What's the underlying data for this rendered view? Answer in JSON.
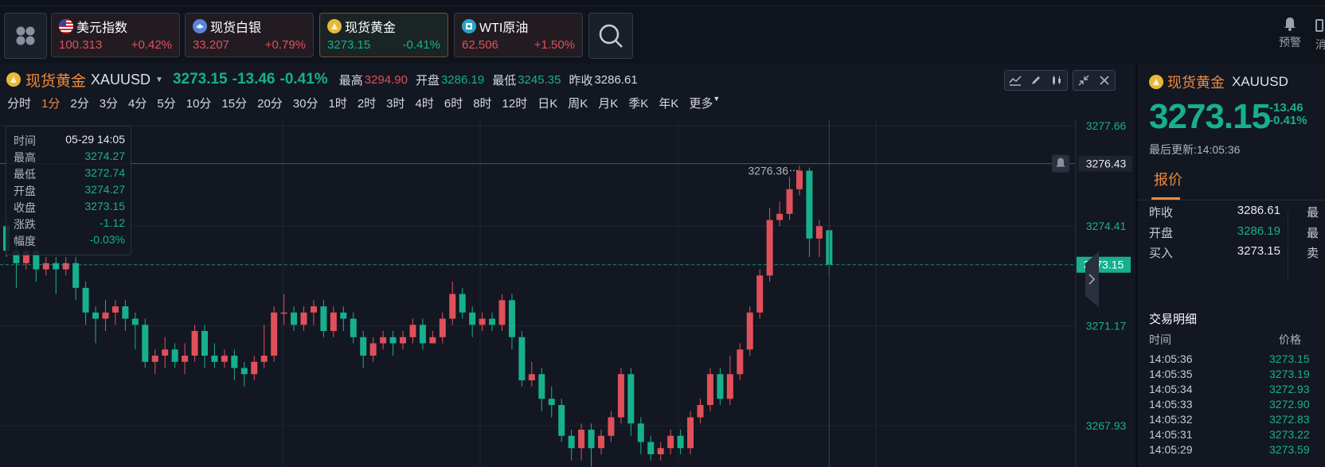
{
  "topbar": {
    "tickers": [
      {
        "name": "美元指数",
        "price": "100.313",
        "change": "+0.42%",
        "icon": "us-flag-icon"
      },
      {
        "name": "现货白银",
        "price": "33.207",
        "change": "+0.79%",
        "icon": "silver-icon"
      },
      {
        "name": "现货黄金",
        "price": "3273.15",
        "change": "-0.41%",
        "icon": "gold-icon"
      },
      {
        "name": "WTI原油",
        "price": "62.506",
        "change": "+1.50%",
        "icon": "oil-icon"
      }
    ],
    "alert_label": "预警",
    "edge_label": "消"
  },
  "chart": {
    "symbol_name": "现货黄金",
    "symbol_code": "XAUUSD",
    "price": "3273.15",
    "change": "-13.46",
    "change_pct": "-0.41%",
    "high_label": "最高",
    "high": "3294.90",
    "open_label": "开盘",
    "open": "3286.19",
    "low_label": "最低",
    "low": "3245.35",
    "prev_label": "昨收",
    "prev": "3286.61",
    "periods": [
      "分时",
      "1分",
      "2分",
      "3分",
      "4分",
      "5分",
      "10分",
      "15分",
      "20分",
      "30分",
      "1时",
      "2时",
      "3时",
      "4时",
      "6时",
      "8时",
      "12时",
      "日K",
      "周K",
      "月K",
      "季K",
      "年K",
      "更多"
    ],
    "active_period": "1分",
    "price_axis": [
      "3277.66",
      "3276.43",
      "3274.41",
      "3273.15",
      "3271.17",
      "3267.93"
    ],
    "max_annotation": "3276.36",
    "tooltip": {
      "rows": [
        {
          "k": "时间",
          "v": "05-29 14:05"
        },
        {
          "k": "最高",
          "v": "3274.27"
        },
        {
          "k": "最低",
          "v": "3272.74"
        },
        {
          "k": "开盘",
          "v": "3274.27"
        },
        {
          "k": "收盘",
          "v": "3273.15"
        },
        {
          "k": "涨跌",
          "v": "-1.12"
        },
        {
          "k": "幅度",
          "v": "-0.03%"
        }
      ]
    },
    "candles": [
      [
        3274.4,
        3273.6,
        3274.6,
        3273.4
      ],
      [
        3273.6,
        3273.2,
        3273.8,
        3272.4
      ],
      [
        3273.2,
        3273.6,
        3274.0,
        3273.0
      ],
      [
        3273.6,
        3273.0,
        3273.8,
        3272.6
      ],
      [
        3273.0,
        3273.2,
        3273.4,
        3272.8
      ],
      [
        3273.2,
        3273.0,
        3273.4,
        3272.2
      ],
      [
        3273.0,
        3273.2,
        3273.4,
        3272.8
      ],
      [
        3273.2,
        3272.4,
        3273.4,
        3272.0
      ],
      [
        3272.4,
        3271.6,
        3272.6,
        3271.2
      ],
      [
        3271.6,
        3271.4,
        3271.8,
        3270.6
      ],
      [
        3271.4,
        3271.6,
        3272.0,
        3271.0
      ],
      [
        3271.6,
        3271.8,
        3272.0,
        3271.2
      ],
      [
        3271.8,
        3271.4,
        3272.0,
        3271.0
      ],
      [
        3271.4,
        3271.2,
        3271.6,
        3270.4
      ],
      [
        3271.2,
        3270.0,
        3271.4,
        3269.8
      ],
      [
        3270.0,
        3270.2,
        3270.4,
        3269.6
      ],
      [
        3270.2,
        3270.4,
        3270.8,
        3269.8
      ],
      [
        3270.4,
        3270.0,
        3270.6,
        3269.8
      ],
      [
        3270.0,
        3270.2,
        3270.6,
        3269.6
      ],
      [
        3270.2,
        3271.0,
        3271.2,
        3270.0
      ],
      [
        3271.0,
        3270.2,
        3271.2,
        3269.8
      ],
      [
        3270.2,
        3270.0,
        3270.6,
        3269.8
      ],
      [
        3270.0,
        3270.2,
        3270.4,
        3269.8
      ],
      [
        3270.2,
        3269.8,
        3270.4,
        3269.4
      ],
      [
        3269.8,
        3269.6,
        3270.0,
        3269.2
      ],
      [
        3269.6,
        3270.0,
        3270.2,
        3269.4
      ],
      [
        3270.0,
        3270.2,
        3271.2,
        3269.8
      ],
      [
        3270.2,
        3271.6,
        3271.8,
        3270.0
      ],
      [
        3271.6,
        3271.6,
        3272.2,
        3271.2
      ],
      [
        3271.6,
        3271.2,
        3271.8,
        3271.0
      ],
      [
        3271.2,
        3271.6,
        3271.8,
        3271.0
      ],
      [
        3271.6,
        3271.8,
        3272.0,
        3271.2
      ],
      [
        3271.8,
        3271.0,
        3272.0,
        3270.8
      ],
      [
        3271.0,
        3271.6,
        3271.8,
        3270.8
      ],
      [
        3271.6,
        3271.4,
        3271.8,
        3271.0
      ],
      [
        3271.4,
        3270.8,
        3271.6,
        3270.6
      ],
      [
        3270.8,
        3270.2,
        3271.0,
        3269.8
      ],
      [
        3270.2,
        3270.6,
        3270.8,
        3270.0
      ],
      [
        3270.6,
        3270.8,
        3271.0,
        3270.4
      ],
      [
        3270.8,
        3270.6,
        3271.0,
        3270.2
      ],
      [
        3270.6,
        3270.8,
        3271.0,
        3270.4
      ],
      [
        3270.8,
        3271.2,
        3271.4,
        3270.6
      ],
      [
        3271.2,
        3270.6,
        3271.4,
        3270.4
      ],
      [
        3270.6,
        3270.8,
        3271.0,
        3270.6
      ],
      [
        3270.8,
        3271.4,
        3271.6,
        3270.6
      ],
      [
        3271.4,
        3272.2,
        3272.6,
        3271.2
      ],
      [
        3272.2,
        3271.6,
        3272.4,
        3271.4
      ],
      [
        3271.6,
        3271.2,
        3271.8,
        3270.8
      ],
      [
        3271.2,
        3271.4,
        3271.6,
        3271.0
      ],
      [
        3271.4,
        3271.2,
        3271.6,
        3271.0
      ],
      [
        3271.2,
        3272.0,
        3272.2,
        3271.0
      ],
      [
        3272.0,
        3270.8,
        3272.2,
        3270.4
      ],
      [
        3270.8,
        3269.4,
        3271.0,
        3269.2
      ],
      [
        3269.4,
        3269.6,
        3270.0,
        3269.2
      ],
      [
        3269.6,
        3268.8,
        3269.8,
        3268.4
      ],
      [
        3268.8,
        3268.6,
        3269.2,
        3268.2
      ],
      [
        3268.6,
        3267.6,
        3268.8,
        3267.4
      ],
      [
        3267.6,
        3267.2,
        3267.8,
        3266.8
      ],
      [
        3267.2,
        3267.8,
        3268.0,
        3266.8
      ],
      [
        3267.8,
        3267.2,
        3268.0,
        3266.6
      ],
      [
        3267.2,
        3267.6,
        3267.8,
        3267.0
      ],
      [
        3267.6,
        3268.2,
        3268.4,
        3267.4
      ],
      [
        3268.2,
        3269.6,
        3269.8,
        3268.0
      ],
      [
        3269.6,
        3268.0,
        3269.8,
        3267.6
      ],
      [
        3268.0,
        3267.4,
        3268.2,
        3267.0
      ],
      [
        3267.4,
        3267.0,
        3267.6,
        3266.8
      ],
      [
        3267.0,
        3267.2,
        3267.4,
        3266.8
      ],
      [
        3267.2,
        3267.6,
        3267.8,
        3267.0
      ],
      [
        3267.6,
        3267.2,
        3267.8,
        3267.0
      ],
      [
        3267.2,
        3268.2,
        3268.4,
        3267.0
      ],
      [
        3268.2,
        3268.6,
        3268.8,
        3268.0
      ],
      [
        3268.6,
        3269.6,
        3269.8,
        3268.4
      ],
      [
        3269.6,
        3268.8,
        3269.8,
        3268.6
      ],
      [
        3268.8,
        3269.6,
        3270.2,
        3268.6
      ],
      [
        3269.6,
        3270.4,
        3270.6,
        3269.4
      ],
      [
        3270.4,
        3271.6,
        3271.8,
        3270.2
      ],
      [
        3271.6,
        3272.8,
        3273.0,
        3271.4
      ],
      [
        3272.8,
        3274.6,
        3275.0,
        3272.6
      ],
      [
        3274.6,
        3274.8,
        3275.2,
        3274.4
      ],
      [
        3274.8,
        3275.6,
        3276.0,
        3274.6
      ],
      [
        3275.6,
        3276.2,
        3276.36,
        3275.4
      ],
      [
        3276.2,
        3274.0,
        3276.3,
        3273.4
      ],
      [
        3274.0,
        3274.4,
        3274.6,
        3273.4
      ],
      [
        3274.27,
        3273.15,
        3274.27,
        3272.74
      ]
    ]
  },
  "right_panel": {
    "symbol_name": "现货黄金",
    "symbol_code": "XAUUSD",
    "price": "3273.15",
    "change": "-13.46",
    "change_pct": "-0.41%",
    "updated": "最后更新:14:05:36",
    "tab_quote": "报价",
    "rows": [
      {
        "k": "昨收",
        "v": "3286.61",
        "side": "最"
      },
      {
        "k": "开盘",
        "v": "3286.19",
        "side": "最"
      },
      {
        "k": "买入",
        "v": "3273.15",
        "side": "卖"
      }
    ],
    "trades_title": "交易明细",
    "col_time": "时间",
    "col_price": "价格",
    "trades": [
      {
        "t": "14:05:36",
        "p": "3273.15"
      },
      {
        "t": "14:05:35",
        "p": "3273.19"
      },
      {
        "t": "14:05:34",
        "p": "3272.93"
      },
      {
        "t": "14:05:33",
        "p": "3272.90"
      },
      {
        "t": "14:05:32",
        "p": "3272.83"
      },
      {
        "t": "14:05:31",
        "p": "3273.22"
      },
      {
        "t": "14:05:29",
        "p": "3273.59"
      }
    ]
  },
  "colors": {
    "up": "#e0505a",
    "down": "#17b08c",
    "accent": "#f08a3c",
    "bg": "#131722"
  }
}
